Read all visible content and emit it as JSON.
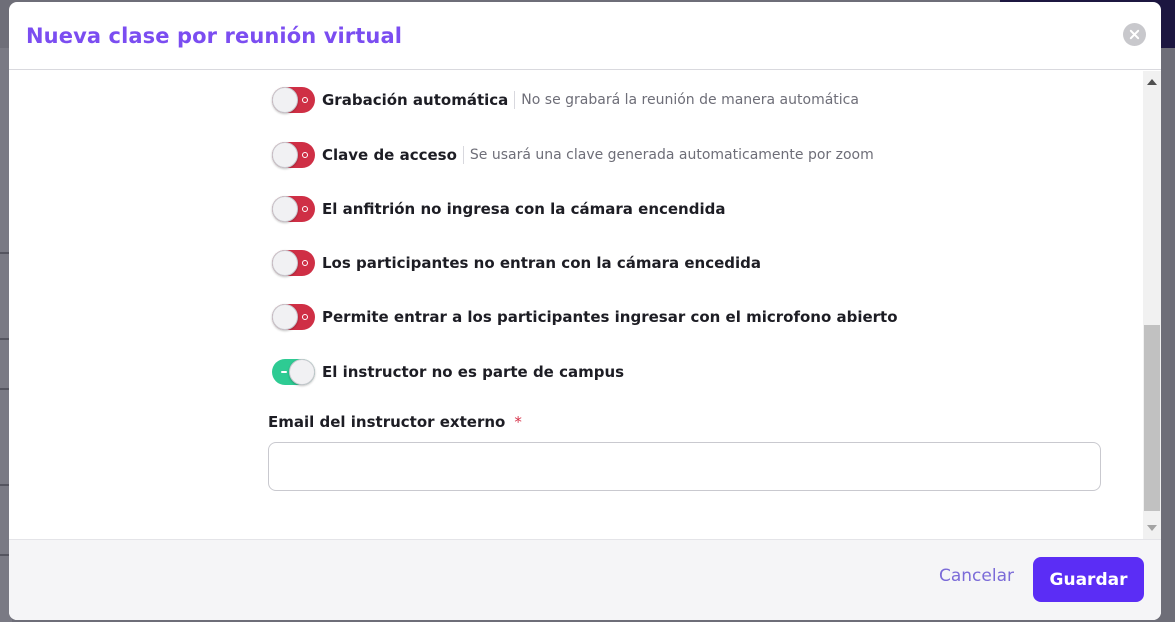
{
  "modal": {
    "title": "Nueva clase por reunión virtual",
    "accent_color": "#7b4df1"
  },
  "toggles": [
    {
      "label": "Grabación automática",
      "description": "No se grabará la reunión de manera automática",
      "state": "off"
    },
    {
      "label": "Clave de acceso",
      "description": "Se usará una clave generada automaticamente por zoom",
      "state": "off"
    },
    {
      "label": "El anfitrión no ingresa con la cámara encendida",
      "description": "",
      "state": "off"
    },
    {
      "label": "Los participantes no entran con la cámara encedida",
      "description": "",
      "state": "off"
    },
    {
      "label": "Permite entrar a los participantes ingresar con el microfono abierto",
      "description": "",
      "state": "off"
    },
    {
      "label": "El instructor no es parte de campus",
      "description": "",
      "state": "on"
    }
  ],
  "colors": {
    "toggle_off": "#cf2f45",
    "toggle_on": "#2ecb93",
    "primary_button": "#5b2df5"
  },
  "email_field": {
    "label": "Email del instructor externo",
    "required_marker": "*",
    "value": "",
    "placeholder": ""
  },
  "footer": {
    "cancel_label": "Cancelar",
    "save_label": "Guardar"
  },
  "icons": {
    "close": "close-icon",
    "scroll_up": "chevron-up-icon",
    "scroll_down": "chevron-down-icon"
  }
}
